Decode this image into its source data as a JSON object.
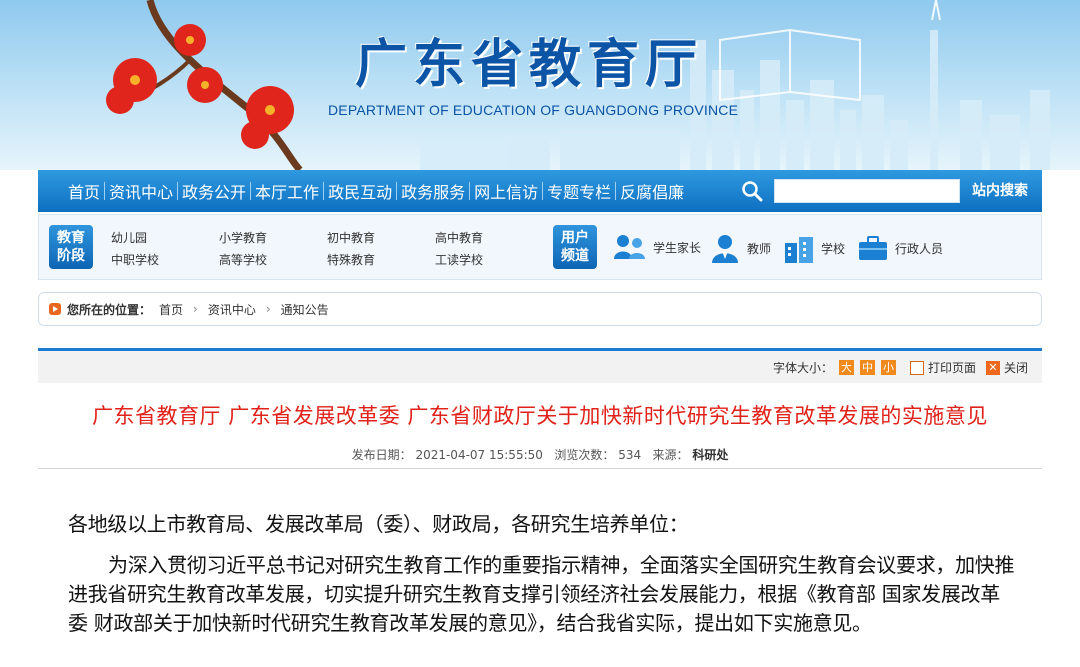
{
  "site": {
    "title": "广东省教育厅",
    "subtitle": "DEPARTMENT OF EDUCATION OF GUANGDONG PROVINCE"
  },
  "nav": {
    "items": [
      "首页",
      "资讯中心",
      "政务公开",
      "本厅工作",
      "政民互动",
      "政务服务",
      "网上信访",
      "专题专栏",
      "反腐倡廉"
    ],
    "search_placeholder": "",
    "search_button": "站内搜索"
  },
  "stages": {
    "badge": [
      "教育",
      "阶段"
    ],
    "links": [
      "幼儿园",
      "小学教育",
      "初中教育",
      "高中教育",
      "中职学校",
      "高等学校",
      "特殊教育",
      "工读学校"
    ]
  },
  "users": {
    "badge": [
      "用户",
      "频道"
    ],
    "items": [
      {
        "label": "学生家长",
        "icon": "parents-icon"
      },
      {
        "label": "教师",
        "icon": "teacher-icon"
      },
      {
        "label": "学校",
        "icon": "school-icon"
      },
      {
        "label": "行政人员",
        "icon": "briefcase-icon"
      }
    ]
  },
  "breadcrumb": {
    "label": "您所在的位置：",
    "items": [
      "首页",
      "资讯中心",
      "通知公告"
    ]
  },
  "tools": {
    "font_size_label": "字体大小：",
    "sizes": [
      "大",
      "中",
      "小"
    ],
    "print": "打印页面",
    "close": "关闭"
  },
  "article": {
    "title": "广东省教育厅 广东省发展改革委 广东省财政厅关于加快新时代研究生教育改革发展的实施意见",
    "publish_label": "发布日期：",
    "publish_date": "2021-04-07 15:55:50",
    "views_label": "浏览次数：",
    "views": "534",
    "source_label": "来源：",
    "source": "科研处",
    "salutation": "各地级以上市教育局、发展改革局（委）、财政局，各研究生培养单位：",
    "paragraph": "为深入贯彻习近平总书记对研究生教育工作的重要指示精神，全面落实全国研究生教育会议要求，加快推进我省研究生教育改革发展，切实提升研究生教育支撑引领经济社会发展能力，根据《教育部 国家发展改革委 财政部关于加快新时代研究生教育改革发展的意见》，结合我省实际，提出如下实施意见。"
  },
  "colors": {
    "nav_blue": "#0e6fc1",
    "title_red": "#e1221a",
    "accent_orange": "#f08a1c"
  }
}
